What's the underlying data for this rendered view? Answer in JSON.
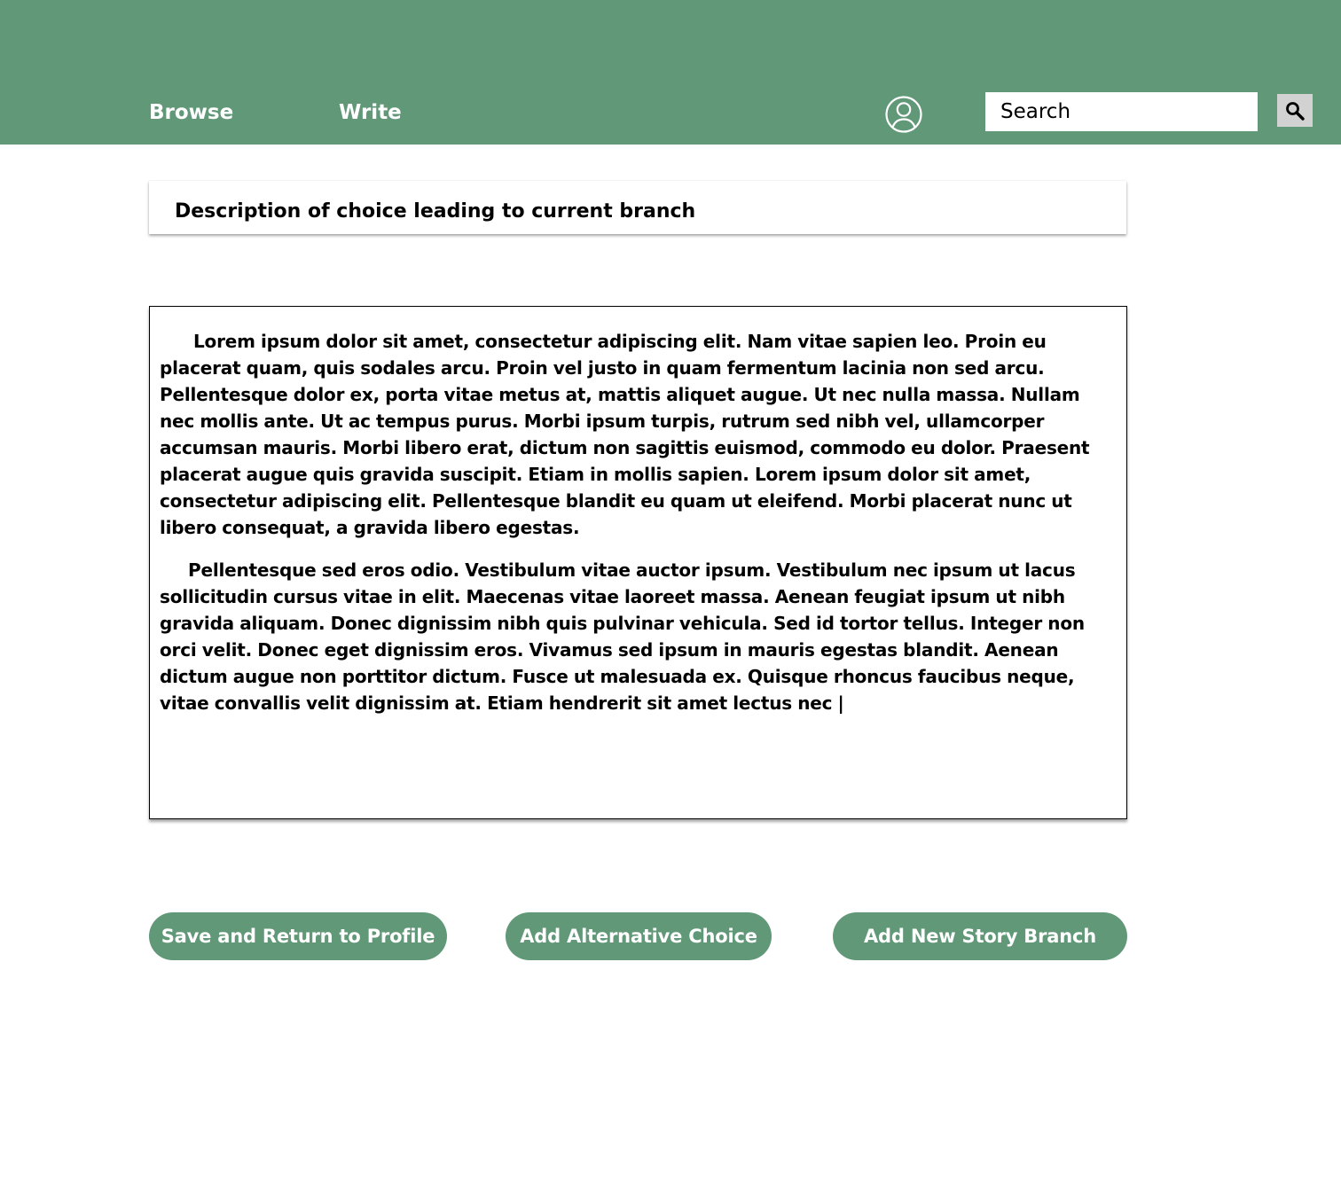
{
  "header": {
    "nav": {
      "browse_label": "Browse",
      "write_label": "Write"
    },
    "profile_icon": "user-circle-icon",
    "search": {
      "placeholder": "Search",
      "value": "",
      "button_icon": "search-icon"
    }
  },
  "choice": {
    "description": "Description of choice leading to current branch"
  },
  "story": {
    "paragraphs": [
      "Lorem ipsum dolor sit amet, consectetur adipiscing elit. Nam vitae sapien leo. Proin eu placerat quam, quis sodales arcu. Proin vel justo in quam fermentum lacinia non sed arcu. Pellentesque dolor ex, porta vitae metus at, mattis aliquet augue. Ut nec nulla massa. Nullam nec mollis ante. Ut ac tempus purus. Morbi ipsum turpis, rutrum sed nibh vel, ullamcorper accumsan mauris. Morbi libero erat, dictum non sagittis euismod, commodo eu dolor. Praesent placerat augue quis gravida suscipit. Etiam in mollis sapien. Lorem ipsum dolor sit amet, consectetur adipiscing elit. Pellentesque blandit eu quam ut eleifend. Morbi placerat nunc ut libero consequat, a gravida libero egestas.",
      "Pellentesque sed eros odio. Vestibulum vitae auctor ipsum. Vestibulum nec ipsum ut lacus sollicitudin cursus vitae in elit. Maecenas vitae laoreet massa. Aenean feugiat ipsum ut nibh gravida aliquam. Donec dignissim nibh quis pulvinar vehicula. Sed id tortor tellus. Integer non orci velit. Donec eget dignissim eros. Vivamus sed ipsum in mauris egestas blandit. Aenean dictum augue non porttitor dictum. Fusce ut malesuada ex. Quisque rhoncus faucibus neque, vitae convallis velit dignissim at. Etiam hendrerit sit amet lectus nec |"
    ]
  },
  "actions": {
    "save_label": "Save and Return to Profile",
    "alternative_label": "Add Alternative Choice",
    "branch_label": "Add New Story Branch"
  },
  "colors": {
    "brand_green": "#619878",
    "search_button_bg": "#d2d2d2",
    "text": "#000000",
    "background": "#ffffff"
  }
}
